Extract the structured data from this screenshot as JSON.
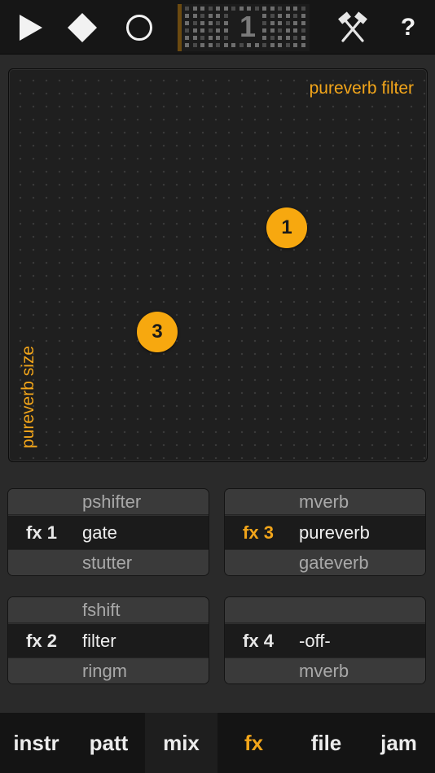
{
  "toolbar": {
    "play_icon": "play-icon",
    "stop_icon": "stop-icon",
    "record_icon": "record-icon",
    "pattern_number": "1",
    "tools_icon": "hammer-icon",
    "help_label": "?"
  },
  "xy_pad": {
    "x_label": "pureverb filter",
    "y_label": "pureverb size",
    "handles": [
      {
        "label": "1"
      },
      {
        "label": "3"
      }
    ]
  },
  "fx_slots": [
    {
      "slot_label": "fx 1",
      "prev": "pshifter",
      "current": "gate",
      "next": "stutter",
      "active": false
    },
    {
      "slot_label": "fx 3",
      "prev": "mverb",
      "current": "pureverb",
      "next": "gateverb",
      "active": true
    },
    {
      "slot_label": "fx 2",
      "prev": "fshift",
      "current": "filter",
      "next": "ringm",
      "active": false
    },
    {
      "slot_label": "fx 4",
      "prev": "",
      "current": "-off-",
      "next": "mverb",
      "active": false
    }
  ],
  "tabs": [
    {
      "label": "instr"
    },
    {
      "label": "patt"
    },
    {
      "label": "mix"
    },
    {
      "label": "fx",
      "active": true
    },
    {
      "label": "file"
    },
    {
      "label": "jam"
    }
  ],
  "colors": {
    "accent": "#f2a51a",
    "background": "#2a2a2a",
    "toolbar": "#161616"
  }
}
